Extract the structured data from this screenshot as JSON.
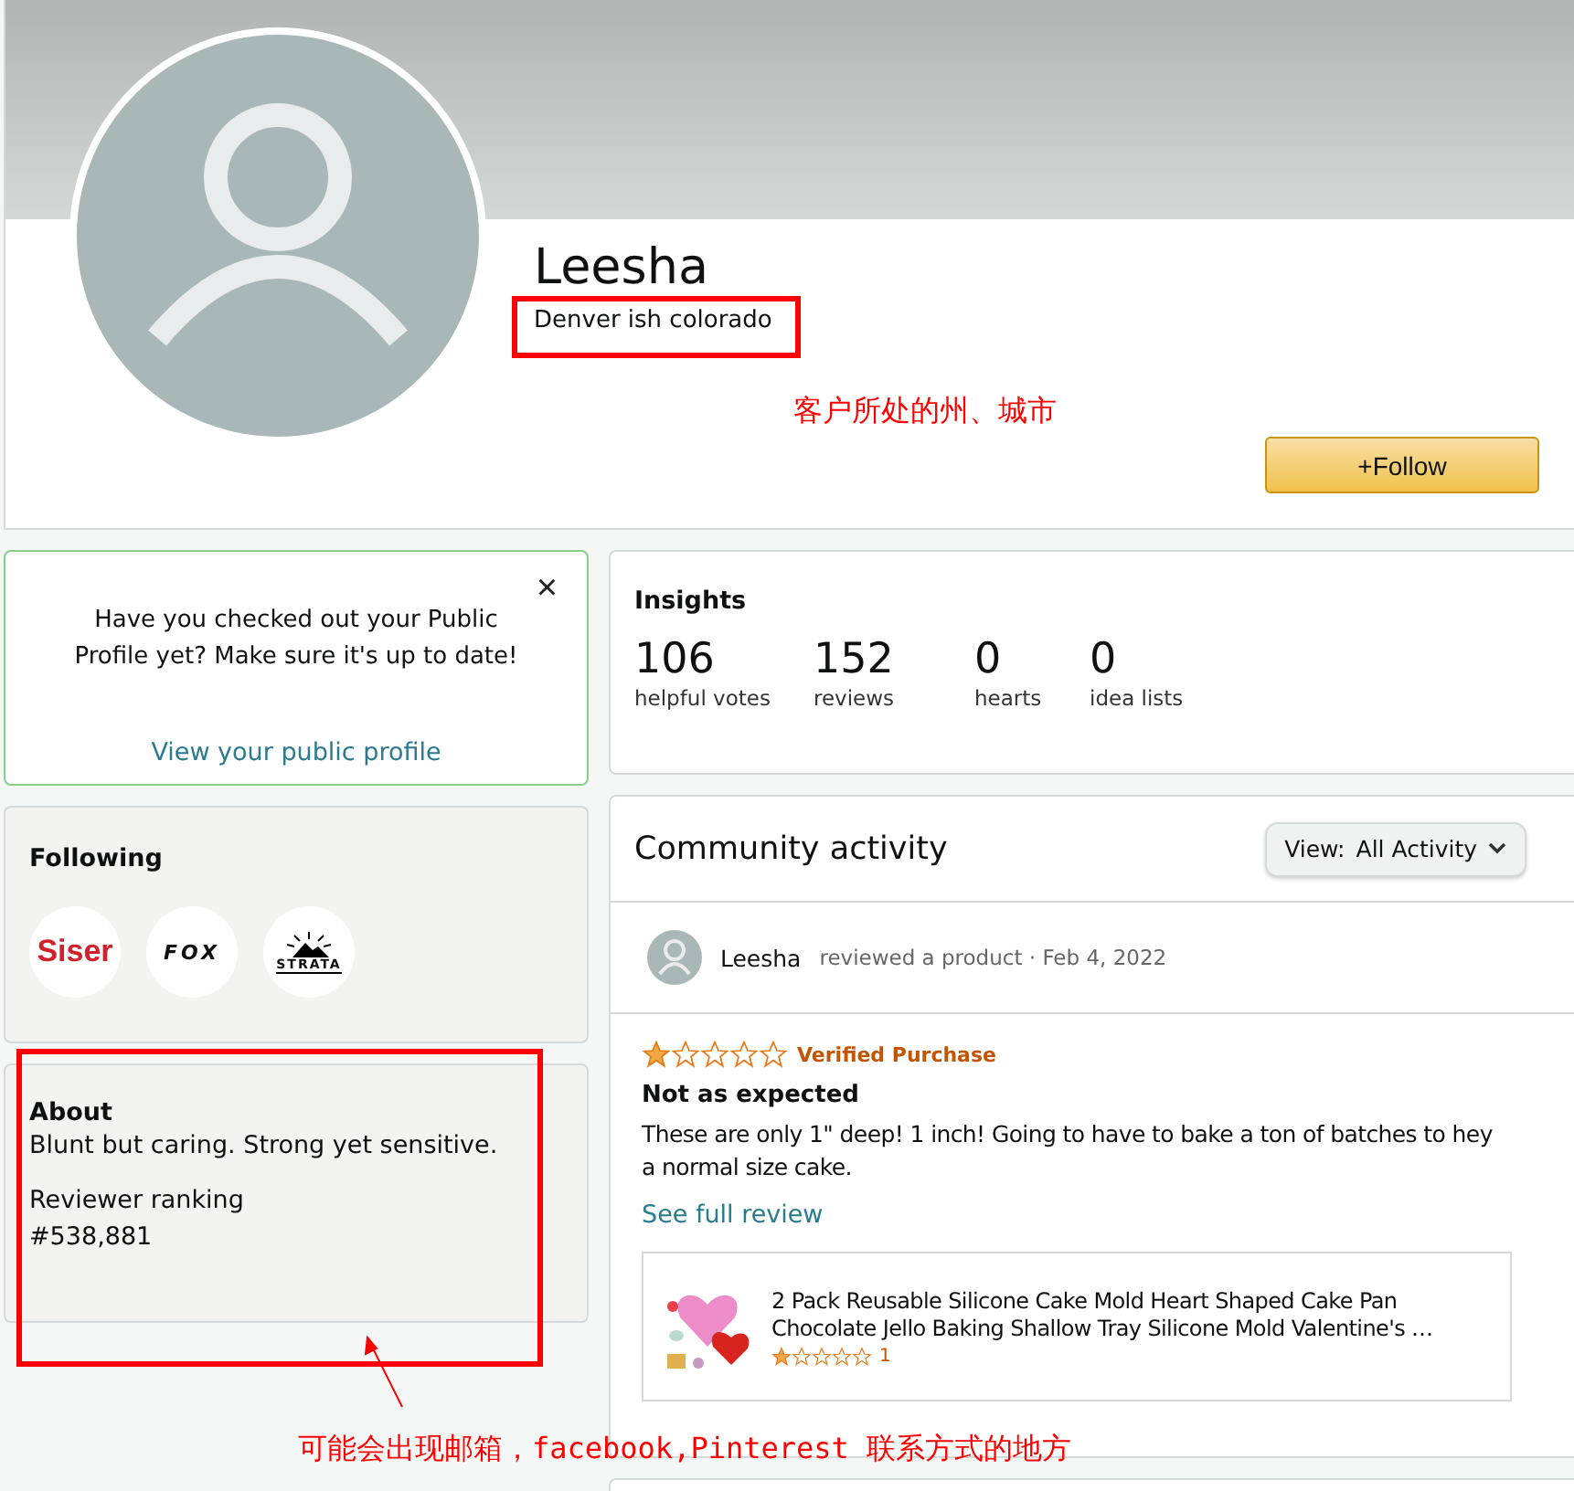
{
  "profile": {
    "name": "Leesha",
    "location": "Denver ish colorado",
    "follow_button": "+Follow"
  },
  "public_profile_card": {
    "message": "Have you checked out your Public Profile yet? Make sure it's up to date!",
    "link": "View your public profile",
    "close": "×"
  },
  "following": {
    "title": "Following",
    "brands": [
      {
        "label": "Siser",
        "kind": "siser"
      },
      {
        "label": "FOX",
        "kind": "fox"
      },
      {
        "label": "STRATA",
        "kind": "strata"
      }
    ]
  },
  "about": {
    "title": "About",
    "bio": "Blunt but caring. Strong yet sensitive.",
    "ranking_label": "Reviewer ranking",
    "ranking": "#538,881"
  },
  "insights": {
    "title": "Insights",
    "stats": [
      {
        "value": "106",
        "label": "helpful votes"
      },
      {
        "value": "152",
        "label": "reviews"
      },
      {
        "value": "0",
        "label": "hearts"
      },
      {
        "value": "0",
        "label": "idea lists"
      }
    ]
  },
  "community": {
    "title": "Community activity",
    "view_label": "View:",
    "view_value": "All Activity",
    "activity": {
      "user": "Leesha",
      "action": "reviewed a product · Feb 4, 2022",
      "review": {
        "stars": 1,
        "badge": "Verified Purchase",
        "title": "Not as expected",
        "body": "These are only 1\" deep! 1 inch! Going to have to bake a ton of batches to hey a normal size cake.",
        "link": "See full review",
        "product": {
          "title": "2 Pack Reusable Silicone Cake Mold Heart Shaped Cake Pan Chocolate Jello Baking Shallow Tray Silicone Mold Valentine's …",
          "stars": 1,
          "rating_count": "1"
        }
      }
    }
  },
  "annotations": [
    "客户所处的州、城市",
    "可能会出现邮箱，facebook,Pinterest 联系方式的地方"
  ]
}
